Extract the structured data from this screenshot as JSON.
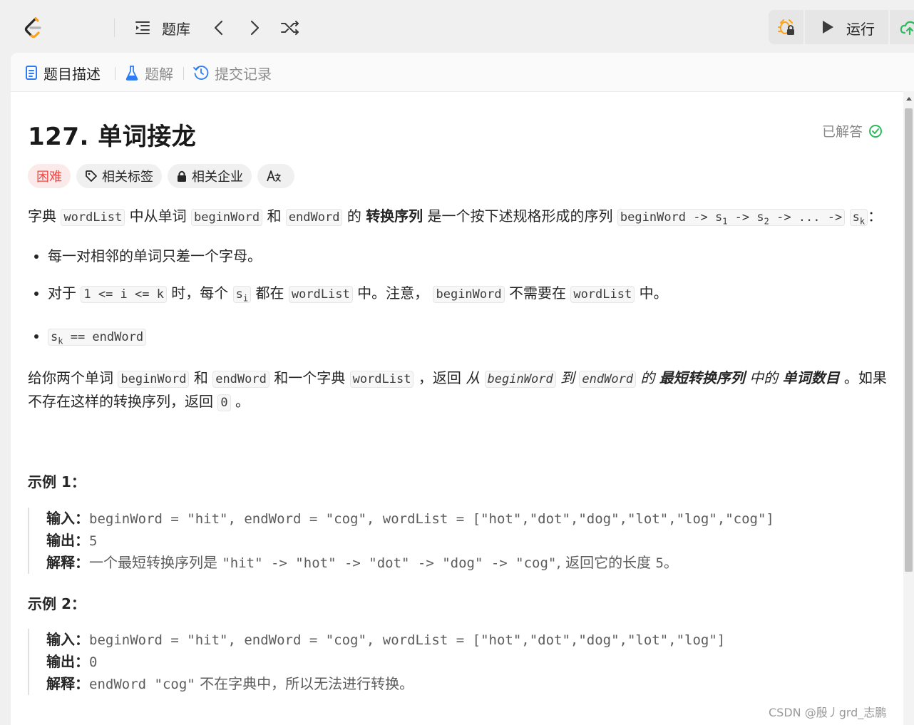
{
  "topbar": {
    "nav_label": "题库",
    "run_label": "运行"
  },
  "tabs": {
    "description": "题目描述",
    "solutions": "题解",
    "submissions": "提交记录"
  },
  "problem": {
    "title": "127. 单词接龙",
    "status": "已解答",
    "difficulty": "困难",
    "tag_topics": "相关标签",
    "tag_companies": "相关企业",
    "tag_translate": "Aあ"
  },
  "description": {
    "p1_a": "字典 ",
    "p1_code1": "wordList",
    "p1_b": " 中从单词 ",
    "p1_code2": "beginWord",
    "p1_c": " 和 ",
    "p1_code3": "endWord",
    "p1_d": " 的 ",
    "p1_bold": "转换序列",
    "p1_e": " 是一个按下述规格形成的序列 ",
    "p1_seq": "beginWord -> s",
    "p1_seq_1": "1",
    "p1_seq_mid": " -> s",
    "p1_seq_2": "2",
    "p1_seq_end": " -> ... ->",
    "p1_sk": "s",
    "p1_sk_sub": "k",
    "p1_colon": "：",
    "li1": "每一对相邻的单词只差一个字母。",
    "li2_a": " 对于 ",
    "li2_code1": "1 <= i <= k",
    "li2_b": " 时，每个 ",
    "li2_si": "s",
    "li2_si_sub": "i",
    "li2_c": " 都在 ",
    "li2_code2": "wordList",
    "li2_d": " 中。注意， ",
    "li2_code3": "beginWord",
    "li2_e": " 不需要在 ",
    "li2_code4": "wordList",
    "li2_f": " 中。",
    "li3_s": "s",
    "li3_sub": "k",
    "li3_rest": " == endWord",
    "p2_a": "给你两个单词 ",
    "p2_code1": "beginWord",
    "p2_b": " 和 ",
    "p2_code2": "endWord",
    "p2_c": " 和一个字典 ",
    "p2_code3": "wordList",
    "p2_d": " ，返回 ",
    "p2_e": "从 ",
    "p2_code4": "beginWord",
    "p2_f": " 到 ",
    "p2_code5": "endWord",
    "p2_g": " 的 ",
    "p2_bold1": "最短转换序列",
    "p2_h": " 中的 ",
    "p2_bold2": "单词数目",
    "p2_i": " 。如果不存在这样的转换序列，返回 ",
    "p2_code6": "0",
    "p2_j": " 。"
  },
  "examples": [
    {
      "title": "示例 1：",
      "input_key": "输入：",
      "input": "beginWord = \"hit\", endWord = \"cog\", wordList = [\"hot\",\"dot\",\"dog\",\"lot\",\"log\",\"cog\"]",
      "output_key": "输出：",
      "output": "5",
      "explain_key": "解释：",
      "explain_a": "一个最短转换序列是 ",
      "explain_code": "\"hit\" -> \"hot\" -> \"dot\" -> \"dog\" -> \"cog\"",
      "explain_b": ", 返回它的长度 ",
      "explain_num": "5",
      "explain_c": "。"
    },
    {
      "title": "示例 2：",
      "input_key": "输入：",
      "input": "beginWord = \"hit\", endWord = \"cog\", wordList = [\"hot\",\"dot\",\"dog\",\"lot\",\"log\"]",
      "output_key": "输出：",
      "output": "0",
      "explain_key": "解释：",
      "explain_code": "endWord \"cog\"",
      "explain_a": " 不在字典中，所以无法进行转换。"
    }
  ],
  "watermark": "CSDN @殷丿grd_志鹏",
  "colors": {
    "hard": "#ef4743",
    "solved": "#2cbb5d",
    "brand_orange": "#ffa116",
    "submit_green": "#2cbb5d"
  }
}
